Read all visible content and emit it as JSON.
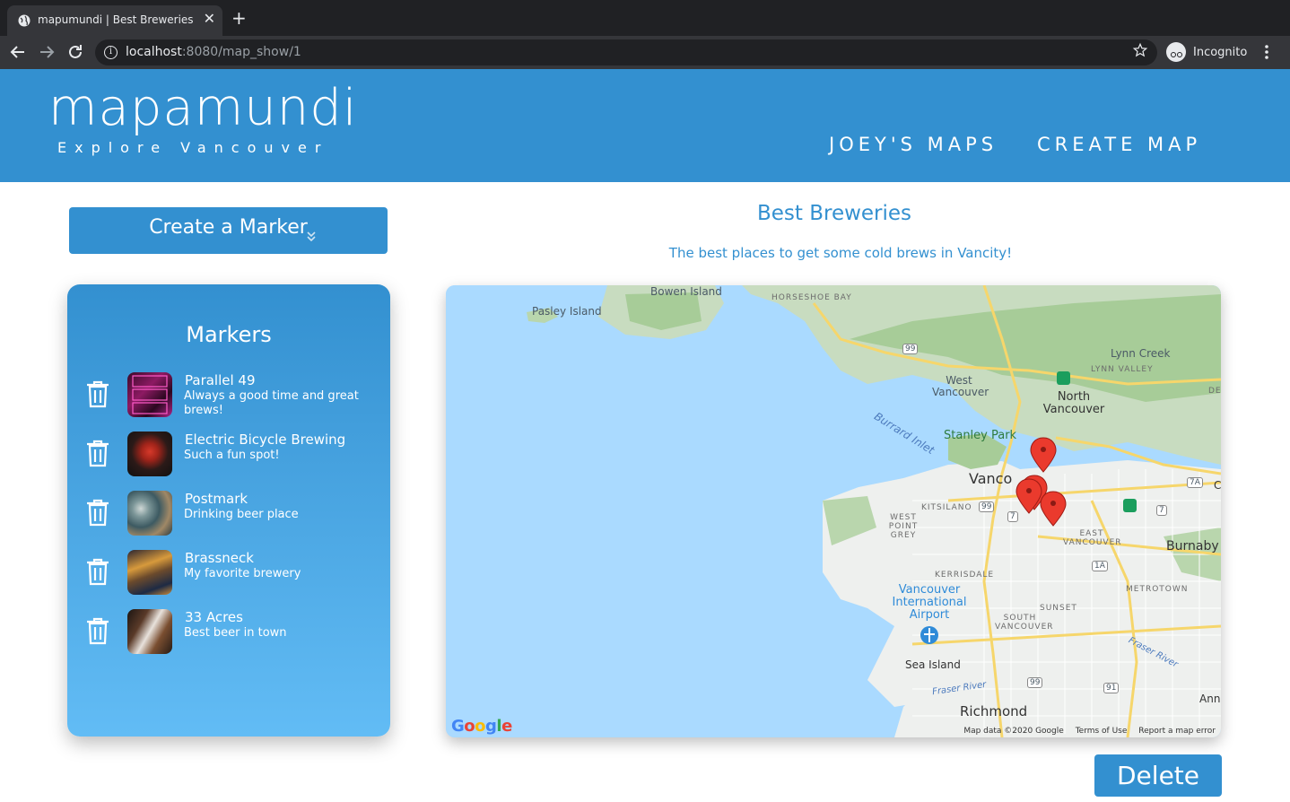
{
  "browser": {
    "tab_title": "mapumundi | Best Breweries",
    "close_glyph": "✕",
    "new_tab_glyph": "+",
    "url_host": "localhost",
    "url_path": ":8080/map_show/1",
    "profile_label": "Incognito",
    "icons": {
      "back": "arrow-left",
      "forward": "arrow-right",
      "reload": "reload",
      "info": "info",
      "bookmark": "star",
      "menu": "vertical-dots"
    }
  },
  "site": {
    "brand": "mapamundi",
    "tagline": "Explore Vancouver",
    "nav": [
      "JOEY'S MAPS",
      "CREATE MAP"
    ],
    "primary_color": "#3390d0"
  },
  "sidebar": {
    "create_button": "Create a Marker",
    "markers_title": "Markers",
    "markers": [
      {
        "name": "Parallel 49",
        "description": "Always a good time and great brews!"
      },
      {
        "name": "Electric Bicycle Brewing",
        "description": "Such a fun spot!"
      },
      {
        "name": "Postmark",
        "description": "Drinking beer place"
      },
      {
        "name": "Brassneck",
        "description": "My favorite brewery"
      },
      {
        "name": "33 Acres",
        "description": "Best beer in town"
      }
    ]
  },
  "map": {
    "title": "Best Breweries",
    "description": "The best places to get some cold brews in Vancity!",
    "labels": {
      "bowen": "Bowen Island",
      "pasley": "Pasley Island",
      "horseshoe": "HORSESHOE BAY",
      "lynn_creek": "Lynn Creek",
      "lynn_valley": "LYNN VALLEY",
      "deep": "DEE",
      "west_vancouver": "West Vancouver",
      "north_vancouver": "North Vancouver",
      "burrard": "Burrard Inlet",
      "stanley": "Stanley Park",
      "vancouver": "Vanco",
      "kitsilano": "KITSILANO",
      "west_point_grey": "WEST POINT GREY",
      "east_vancouver": "EAST VANCOUVER",
      "burnaby": "Burnaby",
      "kerrisdale": "KERRISDALE",
      "metrotown": "METROTOWN",
      "yvr": "Vancouver International Airport",
      "sunset": "SUNSET",
      "south_vancouver": "SOUTH VANCOUVER",
      "fraser_river": "Fraser River",
      "fraser_river2": "Fraser River",
      "sea_island": "Sea Island",
      "richmond": "Richmond",
      "ann": "Ann",
      "c": "C"
    },
    "shields": [
      "99",
      "99",
      "99",
      "7",
      "1A",
      "7A",
      "7",
      "91"
    ],
    "google": "Google",
    "footer": [
      "Map data ©2020 Google",
      "Terms of Use",
      "Report a map error"
    ]
  },
  "actions": {
    "delete": "Delete"
  }
}
